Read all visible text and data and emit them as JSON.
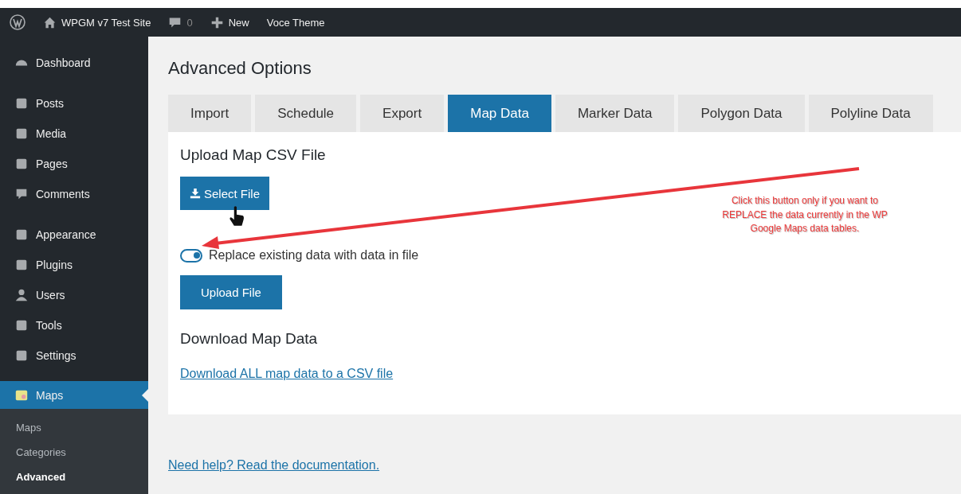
{
  "admin_bar": {
    "site": "WPGM v7 Test Site",
    "comments": "0",
    "new": "New",
    "theme": "Voce Theme"
  },
  "sidebar": {
    "groups": [
      [
        {
          "label": "Dashboard",
          "selected": false
        }
      ],
      [
        {
          "label": "Posts",
          "selected": false
        },
        {
          "label": "Media",
          "selected": false
        },
        {
          "label": "Pages",
          "selected": false
        },
        {
          "label": "Comments",
          "selected": false
        }
      ],
      [
        {
          "label": "Appearance",
          "selected": false
        },
        {
          "label": "Plugins",
          "selected": false
        },
        {
          "label": "Users",
          "selected": false
        },
        {
          "label": "Tools",
          "selected": false
        },
        {
          "label": "Settings",
          "selected": false
        }
      ],
      [
        {
          "label": "Maps",
          "selected": true
        }
      ]
    ],
    "submenu": [
      {
        "label": "Maps",
        "selected": false
      },
      {
        "label": "Categories",
        "selected": false
      },
      {
        "label": "Advanced",
        "selected": true
      }
    ]
  },
  "page": {
    "title": "Advanced Options",
    "tabs": [
      {
        "label": "Import",
        "selected": false
      },
      {
        "label": "Schedule",
        "selected": false
      },
      {
        "label": "Export",
        "selected": false
      },
      {
        "label": "Map Data",
        "selected": true
      },
      {
        "label": "Marker Data",
        "selected": false
      },
      {
        "label": "Polygon Data",
        "selected": false
      },
      {
        "label": "Polyline Data",
        "selected": false
      }
    ],
    "upload_heading": "Upload Map CSV File",
    "select_button": "Select File",
    "replace_toggle": {
      "label": "Replace existing data with data in file",
      "on": true
    },
    "upload_button": "Upload File",
    "download_heading": "Download Map Data",
    "download_link": "Download ALL map data to a CSV file",
    "help_link": "Need help? Read the documentation."
  },
  "annotation": {
    "lines": [
      "Click this button only if you want to",
      "REPLACE the data currently in the WP",
      "Google Maps data tables."
    ]
  }
}
